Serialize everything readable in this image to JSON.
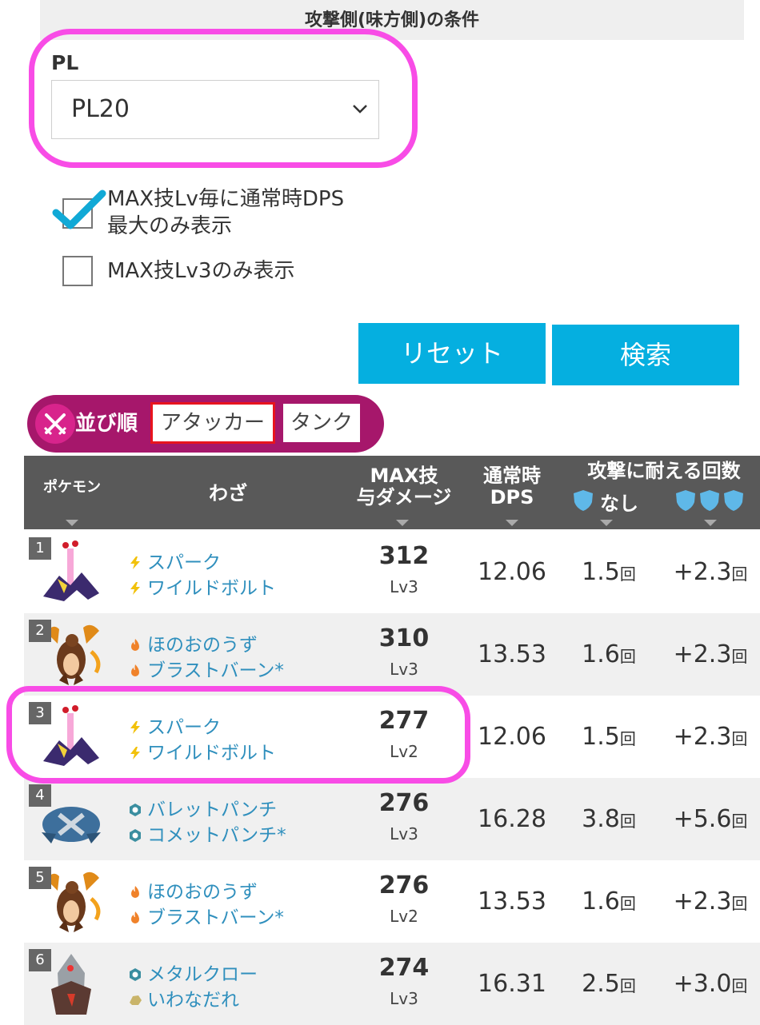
{
  "section_title": "攻撃側(味方側)の条件",
  "pl": {
    "label": "PL",
    "value": "PL20"
  },
  "checkboxes": [
    {
      "line1": "MAX技Lv毎に通常時DPS",
      "line2": "最大のみ表示",
      "checked": true
    },
    {
      "line1": "MAX技Lv3のみ表示",
      "line2": "",
      "checked": false
    }
  ],
  "buttons": {
    "reset": "リセット",
    "search": "検索"
  },
  "sort": {
    "label": "並び順",
    "options": [
      "アタッカー",
      "タンク"
    ],
    "selected": "アタッカー"
  },
  "table": {
    "headers": {
      "pokemon": "ポケモン",
      "moves": "わざ",
      "max_line1": "MAX技",
      "max_line2": "与ダメージ",
      "dps_line1": "通常時",
      "dps_line2": "DPS",
      "endure": "攻撃に耐える回数",
      "none": "なし"
    },
    "rows": [
      {
        "rank": "1",
        "move1": "スパーク",
        "move2": "ワイルドボルト",
        "move1_type": "electric",
        "move2_type": "electric",
        "damage": "312",
        "lv": "Lv3",
        "dps": "12.06",
        "endure_none": "1.5",
        "endure_shield": "+2.3",
        "unit": "回"
      },
      {
        "rank": "2",
        "move1": "ほのおのうず",
        "move2": "ブラストバーン*",
        "move1_type": "fire",
        "move2_type": "fire",
        "damage": "310",
        "lv": "Lv3",
        "dps": "13.53",
        "endure_none": "1.6",
        "endure_shield": "+2.3",
        "unit": "回"
      },
      {
        "rank": "3",
        "move1": "スパーク",
        "move2": "ワイルドボルト",
        "move1_type": "electric",
        "move2_type": "electric",
        "damage": "277",
        "lv": "Lv2",
        "dps": "12.06",
        "endure_none": "1.5",
        "endure_shield": "+2.3",
        "unit": "回"
      },
      {
        "rank": "4",
        "move1": "バレットパンチ",
        "move2": "コメットパンチ*",
        "move1_type": "steel",
        "move2_type": "steel",
        "damage": "276",
        "lv": "Lv3",
        "dps": "16.28",
        "endure_none": "3.8",
        "endure_shield": "+5.6",
        "unit": "回"
      },
      {
        "rank": "5",
        "move1": "ほのおのうず",
        "move2": "ブラストバーン*",
        "move1_type": "fire",
        "move2_type": "fire",
        "damage": "276",
        "lv": "Lv2",
        "dps": "13.53",
        "endure_none": "1.6",
        "endure_shield": "+2.3",
        "unit": "回"
      },
      {
        "rank": "6",
        "move1": "メタルクロー",
        "move2": "いわなだれ",
        "move1_type": "steel",
        "move2_type": "rock",
        "damage": "274",
        "lv": "Lv3",
        "dps": "16.31",
        "endure_none": "2.5",
        "endure_shield": "+3.0",
        "unit": "回"
      }
    ]
  },
  "colors": {
    "accent_blue": "#05afe0",
    "sort_bar": "#a6176b",
    "highlight_pink": "#f84ce6",
    "selected_red": "#e8141e",
    "table_header": "#595959",
    "move_text": "#2f8fbd"
  }
}
